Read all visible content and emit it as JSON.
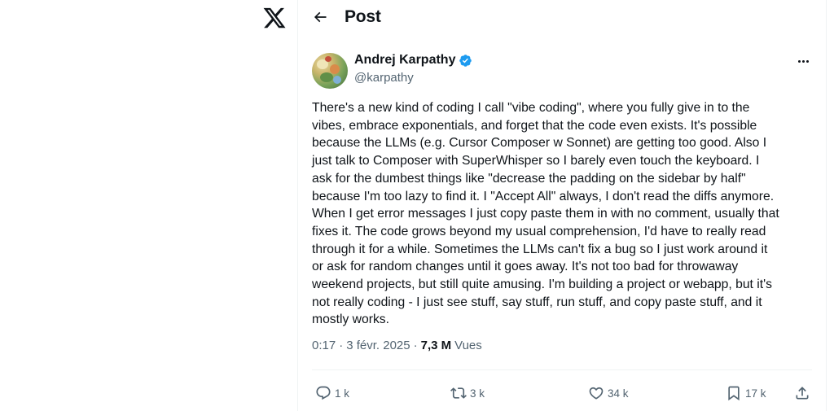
{
  "nav": {
    "logo_icon": "x-logo-icon"
  },
  "header": {
    "title": "Post",
    "back_icon": "arrow-left-icon"
  },
  "author": {
    "name": "Andrej Karpathy",
    "handle": "@karpathy",
    "verified": true,
    "verified_color": "#1d9bf0"
  },
  "tweet": {
    "lines": [
      "There's a new kind of coding I call \"vibe coding\", where you fully give in to the",
      "vibes, embrace exponentials, and forget that the code even exists. It's possible",
      "because the LLMs (e.g. Cursor Composer w Sonnet) are getting too good. Also I",
      "just talk to Composer with SuperWhisper so I barely even touch the keyboard. I",
      "ask for the dumbest things like \"decrease the padding on the sidebar by half\"",
      "because I'm too lazy to find it. I \"Accept All\" always, I don't read the diffs anymore.",
      "When I get error messages I just copy paste them in with no comment, usually that",
      "fixes it. The code grows beyond my usual comprehension, I'd have to really read",
      "through it for a while. Sometimes the LLMs can't fix a bug so I just work around it",
      "or ask for random changes until it goes away. It's not too bad for throwaway",
      "weekend projects, but still quite amusing. I'm building a project or webapp, but it's",
      "not really coding - I just see stuff, say stuff, run stuff, and copy paste stuff, and it",
      "mostly works."
    ]
  },
  "meta": {
    "time": "0:17",
    "sep1": "·",
    "date": "3 févr. 2025",
    "sep2": "·",
    "views_count": "7,3 M",
    "views_label": "Vues"
  },
  "actions": {
    "reply": {
      "icon": "reply-icon",
      "count": "1 k"
    },
    "repost": {
      "icon": "repost-icon",
      "count": "3 k"
    },
    "like": {
      "icon": "heart-icon",
      "count": "34 k"
    },
    "bookmark": {
      "icon": "bookmark-icon",
      "count": "17 k"
    },
    "share": {
      "icon": "share-icon"
    }
  },
  "colors": {
    "text": "#0f1419",
    "secondary": "#536471",
    "border": "#eff3f4",
    "accent": "#1d9bf0"
  }
}
